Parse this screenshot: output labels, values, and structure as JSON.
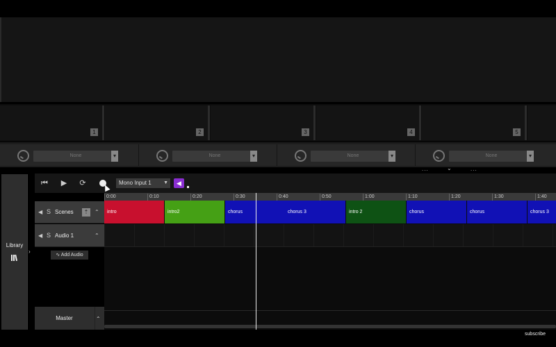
{
  "clip_slots": [
    "1",
    "2",
    "3",
    "4",
    "5"
  ],
  "presets": [
    "None",
    "None",
    "None",
    "None"
  ],
  "toggle_dots": "...",
  "library": {
    "label": "Library",
    "icon": "library-icon"
  },
  "transport": {
    "input_select": "Mono Input 1",
    "icons": [
      "skip-back-icon",
      "play-icon",
      "loop-icon",
      "record-icon",
      "monitor-icon"
    ]
  },
  "ruler_ticks": [
    "0:00",
    "0:10",
    "0:20",
    "0:30",
    "0:40",
    "0:50",
    "1:00",
    "1:10",
    "1:20",
    "1:30",
    "1:40"
  ],
  "tracks": {
    "scenes": {
      "name": "Scenes",
      "solo": "S"
    },
    "audio1": {
      "name": "Audio 1",
      "solo": "S"
    },
    "add_audio": "Add Audio",
    "master": "Master"
  },
  "scenes": [
    {
      "label": "intro",
      "color": "#c8102e"
    },
    {
      "label": "intro2",
      "color": "#45a015"
    },
    {
      "label": "chorus",
      "color": "#1111b5"
    },
    {
      "label": "chorus 3",
      "color": "#1111b5"
    },
    {
      "label": "intro 2",
      "color": "#0e5214"
    },
    {
      "label": "chorus",
      "color": "#1111b5"
    },
    {
      "label": "chorus",
      "color": "#1111b5"
    },
    {
      "label": "chorus 3",
      "color": "#1111b5"
    }
  ],
  "playhead_time": "0:33",
  "subscribe": "subscribe"
}
